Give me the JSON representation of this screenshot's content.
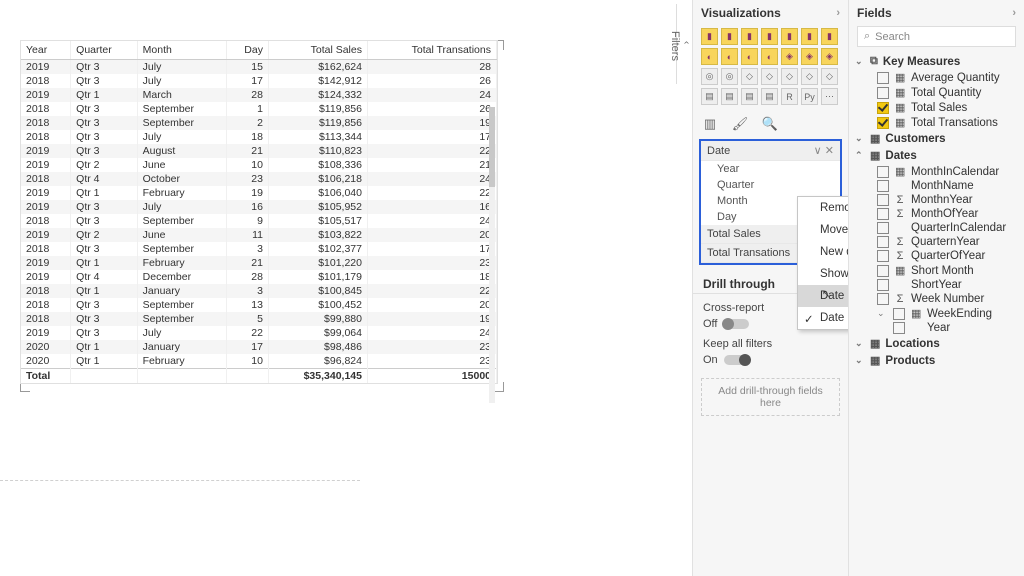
{
  "filtersTab": "Filters",
  "table": {
    "headers": [
      "Year",
      "Quarter",
      "Month",
      "Day",
      "Total Sales",
      "Total Transations"
    ],
    "rows": [
      [
        "2019",
        "Qtr 3",
        "July",
        "15",
        "$162,624",
        "28"
      ],
      [
        "2018",
        "Qtr 3",
        "July",
        "17",
        "$142,912",
        "26"
      ],
      [
        "2019",
        "Qtr 1",
        "March",
        "28",
        "$124,332",
        "24"
      ],
      [
        "2018",
        "Qtr 3",
        "September",
        "1",
        "$119,856",
        "26"
      ],
      [
        "2018",
        "Qtr 3",
        "September",
        "2",
        "$119,856",
        "19"
      ],
      [
        "2018",
        "Qtr 3",
        "July",
        "18",
        "$113,344",
        "17"
      ],
      [
        "2019",
        "Qtr 3",
        "August",
        "21",
        "$110,823",
        "22"
      ],
      [
        "2019",
        "Qtr 2",
        "June",
        "10",
        "$108,336",
        "21"
      ],
      [
        "2018",
        "Qtr 4",
        "October",
        "23",
        "$106,218",
        "24"
      ],
      [
        "2019",
        "Qtr 1",
        "February",
        "19",
        "$106,040",
        "22"
      ],
      [
        "2019",
        "Qtr 3",
        "July",
        "16",
        "$105,952",
        "16"
      ],
      [
        "2018",
        "Qtr 3",
        "September",
        "9",
        "$105,517",
        "24"
      ],
      [
        "2019",
        "Qtr 2",
        "June",
        "11",
        "$103,822",
        "20"
      ],
      [
        "2018",
        "Qtr 3",
        "September",
        "3",
        "$102,377",
        "17"
      ],
      [
        "2019",
        "Qtr 1",
        "February",
        "21",
        "$101,220",
        "23"
      ],
      [
        "2019",
        "Qtr 4",
        "December",
        "28",
        "$101,179",
        "18"
      ],
      [
        "2018",
        "Qtr 1",
        "January",
        "3",
        "$100,845",
        "22"
      ],
      [
        "2018",
        "Qtr 3",
        "September",
        "13",
        "$100,452",
        "20"
      ],
      [
        "2018",
        "Qtr 3",
        "September",
        "5",
        "$99,880",
        "19"
      ],
      [
        "2019",
        "Qtr 3",
        "July",
        "22",
        "$99,064",
        "24"
      ],
      [
        "2020",
        "Qtr 1",
        "January",
        "17",
        "$98,486",
        "23"
      ],
      [
        "2020",
        "Qtr 1",
        "February",
        "10",
        "$96,824",
        "23"
      ]
    ],
    "footer": [
      "Total",
      "",
      "",
      "",
      "$35,340,145",
      "15000"
    ]
  },
  "viz": {
    "title": "Visualizations",
    "well": {
      "date": "Date",
      "year": "Year",
      "quarter": "Quarter",
      "month": "Month",
      "day": "Day",
      "totalSales": "Total Sales",
      "totalTrans": "Total Transations",
      "drill": "Drill through",
      "cross": "Cross-report",
      "off": "Off",
      "keep": "Keep all filters",
      "on": "On",
      "addfields": "Add drill-through fields here"
    },
    "menu": {
      "remove": "Remove field",
      "move": "Move",
      "newQuick": "New quick measure",
      "showItems": "Show items with no data",
      "date": "Date",
      "dateHierarchy": "Date Hierarchy"
    }
  },
  "fields": {
    "title": "Fields",
    "searchPlaceholder": "Search",
    "tables": {
      "keyMeasures": "Key Measures",
      "km_items": [
        {
          "label": "Average Quantity",
          "on": false,
          "sigma": false,
          "icon": "▦"
        },
        {
          "label": "Total Quantity",
          "on": false,
          "sigma": false,
          "icon": "▦"
        },
        {
          "label": "Total Sales",
          "on": true,
          "sigma": false,
          "icon": "▦"
        },
        {
          "label": "Total Transations",
          "on": true,
          "sigma": false,
          "icon": "▦"
        }
      ],
      "customers": "Customers",
      "dates": "Dates",
      "date_items": [
        {
          "label": "MonthInCalendar",
          "sigma": false,
          "icon": "▦"
        },
        {
          "label": "MonthName",
          "sigma": false,
          "icon": ""
        },
        {
          "label": "MonthnYear",
          "sigma": true,
          "icon": ""
        },
        {
          "label": "MonthOfYear",
          "sigma": true,
          "icon": ""
        },
        {
          "label": "QuarterInCalendar",
          "sigma": false,
          "icon": ""
        },
        {
          "label": "QuarternYear",
          "sigma": true,
          "icon": ""
        },
        {
          "label": "QuarterOfYear",
          "sigma": true,
          "icon": ""
        },
        {
          "label": "Short Month",
          "sigma": false,
          "icon": "▦"
        },
        {
          "label": "ShortYear",
          "sigma": false,
          "icon": ""
        },
        {
          "label": "Week Number",
          "sigma": true,
          "icon": ""
        },
        {
          "label": "WeekEnding",
          "sigma": false,
          "icon": "▦",
          "caret": true
        },
        {
          "label": "Year",
          "sigma": false,
          "icon": "",
          "indent": true
        }
      ],
      "locations": "Locations",
      "products": "Products"
    }
  }
}
